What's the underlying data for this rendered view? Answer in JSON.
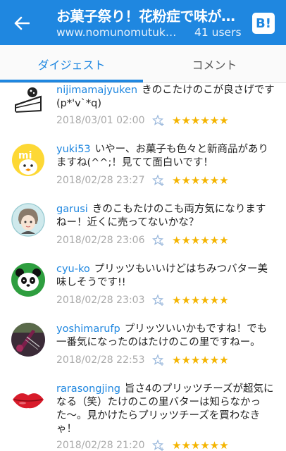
{
  "header": {
    "title": "お菓子祭り！花粉症で味が…",
    "domain": "www.nomunomutuk…",
    "users": "41 users",
    "b_label": "B!"
  },
  "tabs": [
    {
      "label": "ダイジェスト",
      "active": true
    },
    {
      "label": "コメント",
      "active": false
    }
  ],
  "comments": [
    {
      "user": "nijimamajyuken",
      "text": "きのこたけのこが良さげです(p*'v`*q)",
      "date": "2018/03/01 02:00",
      "stars": "★★★★★★",
      "avatar": "cake-icon"
    },
    {
      "user": "yuki53",
      "text": "いやー、お菓子も色々と新商品がありますね(^^;！見てて面白いです！",
      "date": "2018/02/28 23:27",
      "stars": "★★★★★★",
      "avatar": "duck-icon"
    },
    {
      "user": "garusi",
      "text": "きのこもたけのこも両方気になりますねー！近くに売ってないかな？",
      "date": "2018/02/28 23:06",
      "stars": "★★★★★★",
      "avatar": "anime-face-icon"
    },
    {
      "user": "cyu-ko",
      "text": "プリッツもいいけどはちみつバター美味しそうです!!",
      "date": "2018/02/28 23:03",
      "stars": "★★★★★★",
      "avatar": "panda-icon"
    },
    {
      "user": "yoshimarufp",
      "text": "プリッツいいかもですね！でも一番気になったのはたけのこの里ですねー。",
      "date": "2018/02/28 22:53",
      "stars": "★★★★★★",
      "avatar": "guitar-photo-icon"
    },
    {
      "user": "rarasongjing",
      "text": "旨さ4のプリッツチーズが超気になる（笑）たけのこの里バターは知らなかった〜。見かけたらプリッツチーズを買わなきゃ！",
      "date": "2018/02/28 21:20",
      "stars": "★★★★★★",
      "avatar": "lips-icon"
    }
  ]
}
